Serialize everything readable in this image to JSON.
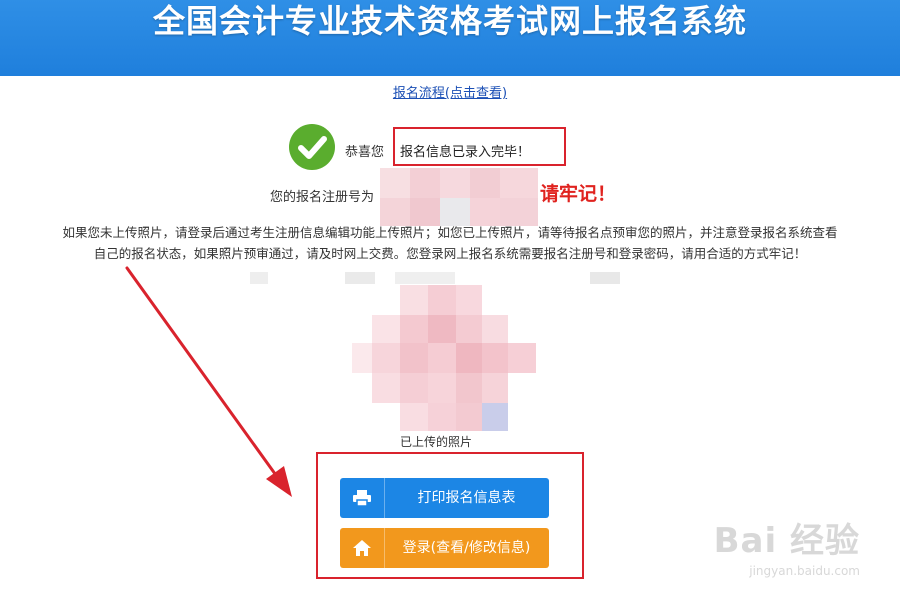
{
  "header": {
    "title": "全国会计专业技术资格考试网上报名系统"
  },
  "links": {
    "process": "报名流程(点击查看)"
  },
  "success": {
    "congrats_label": "恭喜您",
    "message": "报名信息已录入完毕！"
  },
  "registration": {
    "label_prefix": "您的报名注册号为",
    "remember_text": "请牢记！"
  },
  "notice": {
    "line1": "如果您未上传照片，请登录后通过考生注册信息编辑功能上传照片；如您已上传照片，请等待报名点预审您的照片，并注意登录报名系统查看",
    "line2": "自己的报名状态，如果照片预审通过，请及时网上交费。您登录网上报名系统需要报名注册号和登录密码，请用合适的方式牢记！"
  },
  "photo": {
    "caption": "已上传的照片"
  },
  "actions": {
    "print_label": "打印报名信息表",
    "login_label": "登录(查看/修改信息)"
  },
  "watermark": {
    "main": "Bai 经验",
    "sub": "jingyan.baidu.com"
  },
  "colors": {
    "banner": "#1f7fdc",
    "annotation_red": "#d9232d",
    "print_button": "#1c86e5",
    "login_button": "#f2981d",
    "success_green": "#5aad2e"
  }
}
